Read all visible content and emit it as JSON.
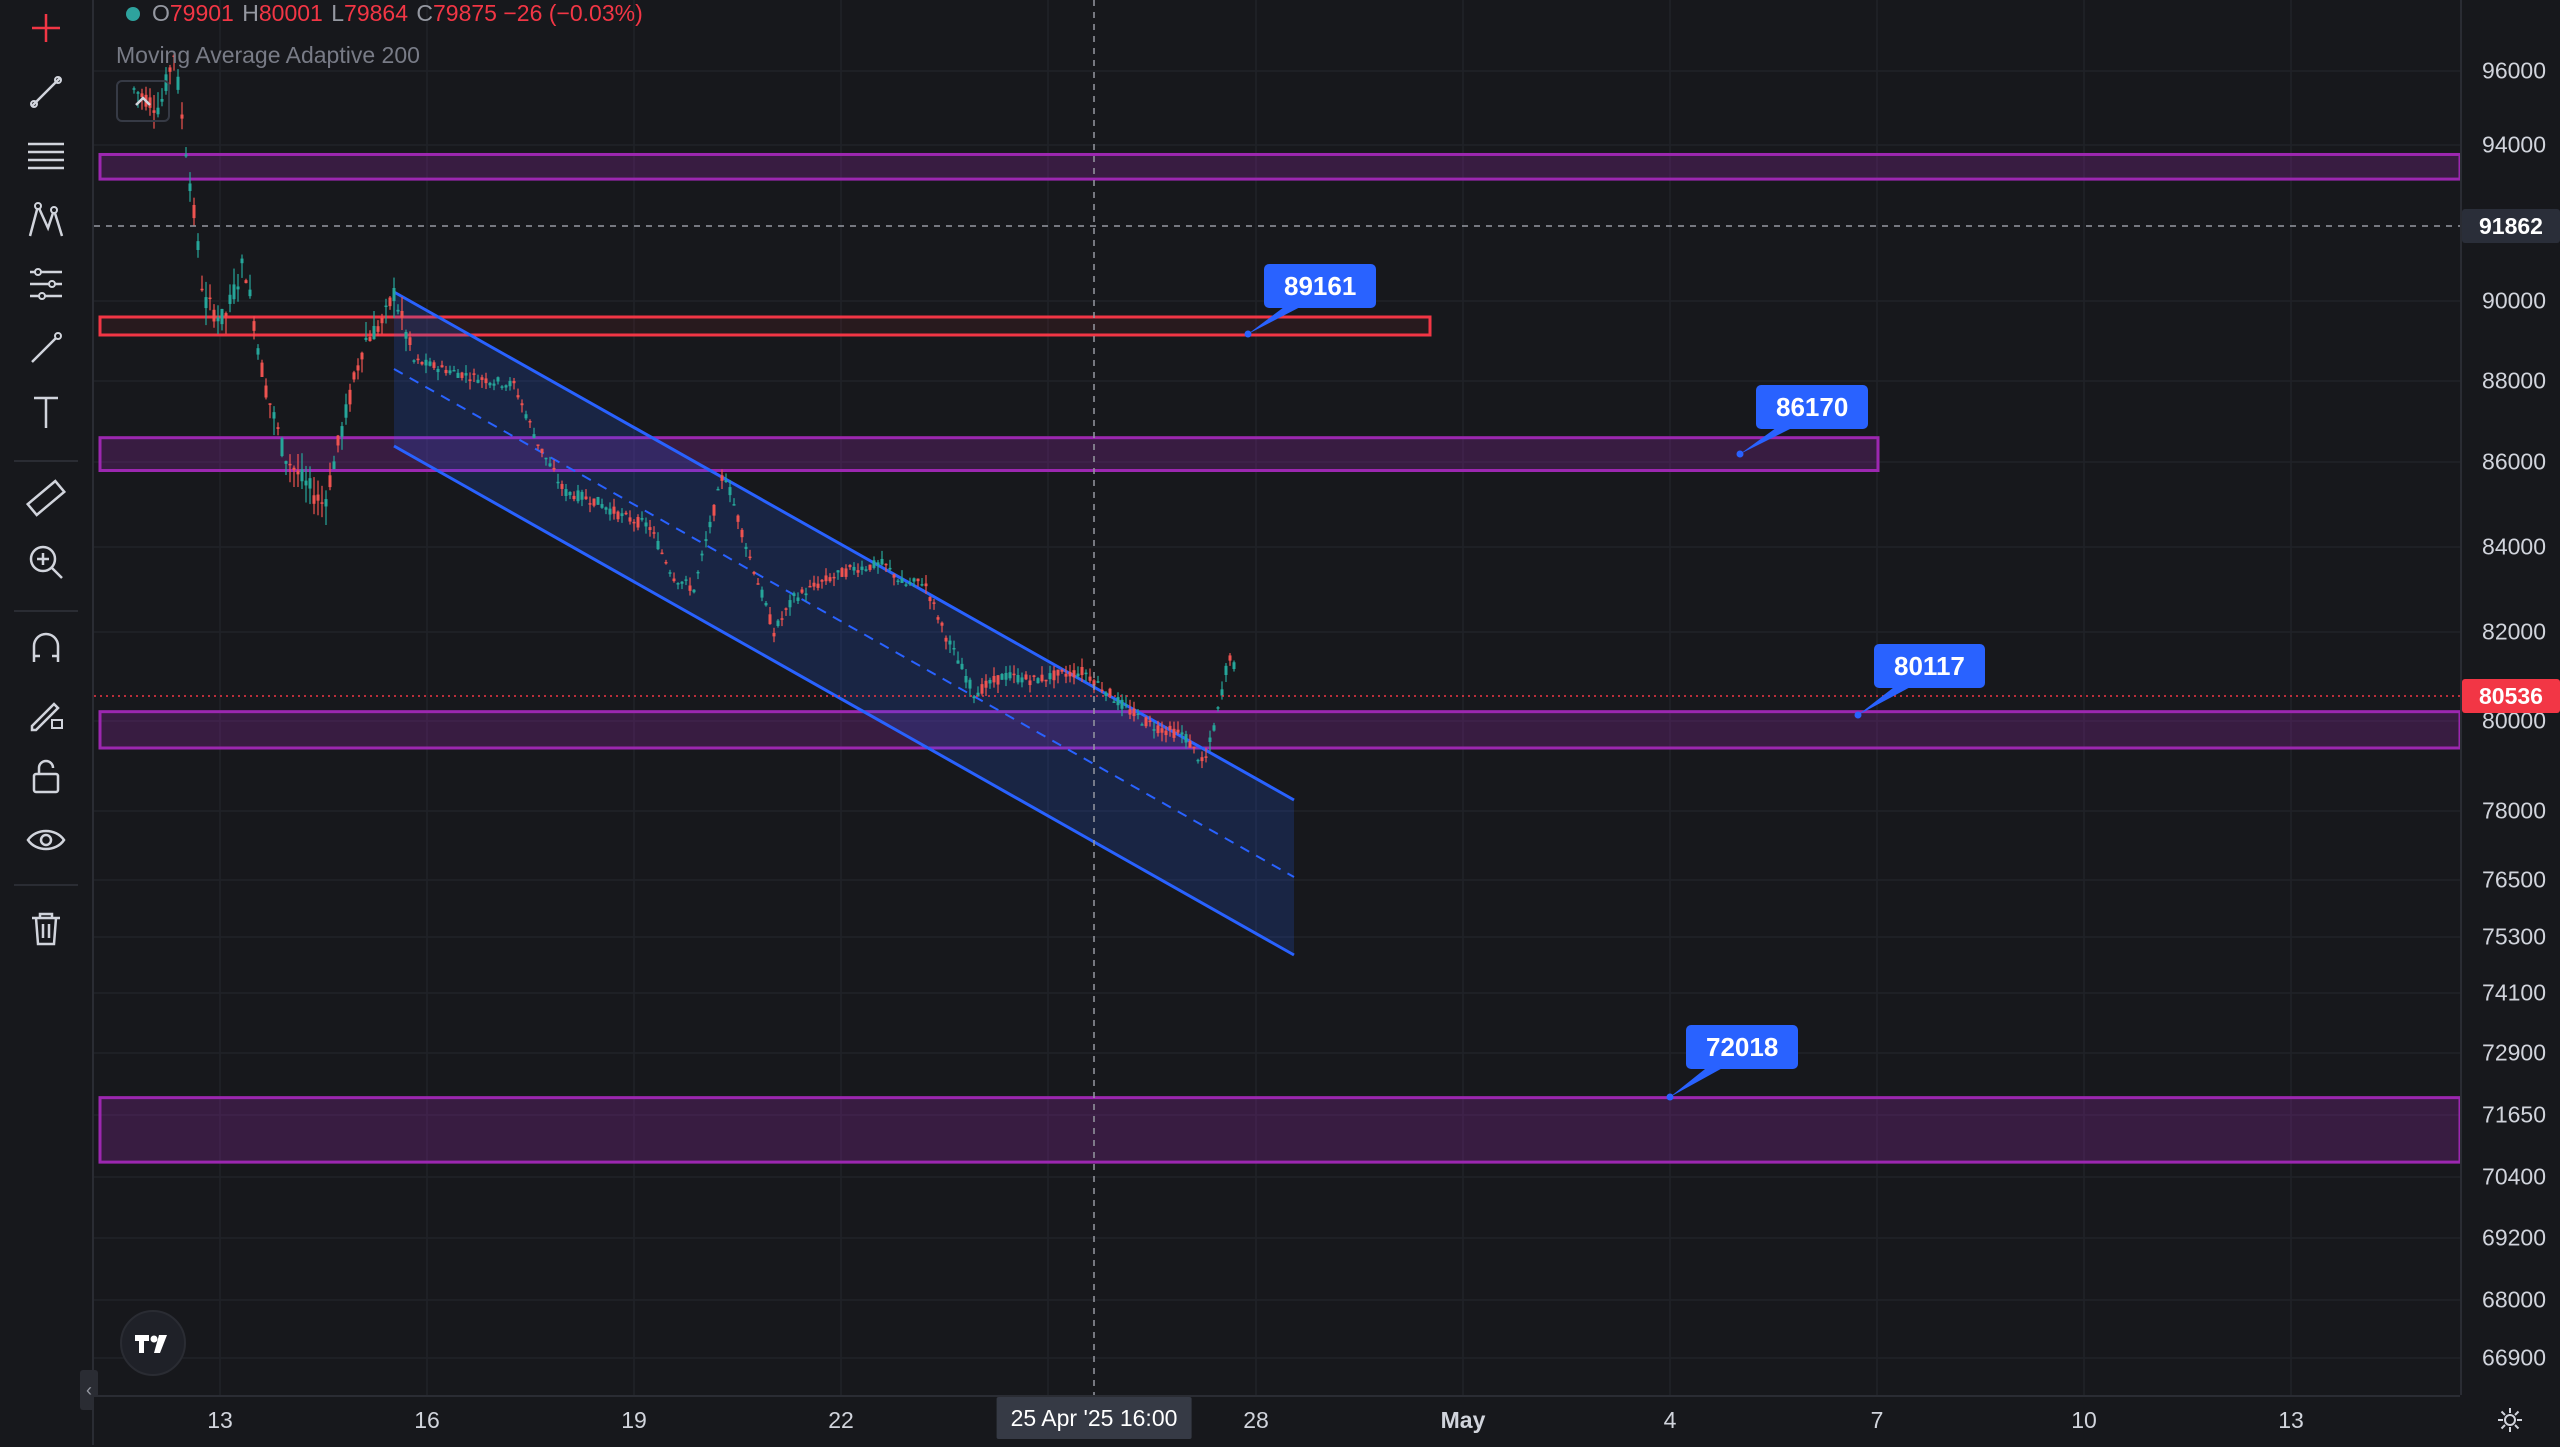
{
  "legend": {
    "open_label": "O",
    "open_value": "79901",
    "high_label": "H",
    "high_value": "80001",
    "low_label": "L",
    "low_value": "79864",
    "close_label": "C",
    "close_value": "79875",
    "change": "−26 (−0.03%)"
  },
  "indicator": {
    "name": "Moving Average Adaptive 200"
  },
  "price_axis": {
    "ticks": [
      "96000",
      "94000",
      "90000",
      "88000",
      "86000",
      "84000",
      "82000",
      "80000",
      "78000",
      "76500",
      "75300",
      "74100",
      "72900",
      "71650",
      "70400",
      "69200",
      "68000",
      "66900"
    ],
    "crosshair_price": "91862",
    "last_price": "80536"
  },
  "time_axis": {
    "ticks": [
      "13",
      "16",
      "19",
      "22",
      "28",
      "May",
      "4",
      "7",
      "10",
      "13"
    ],
    "crosshair_label": "25 Apr '25   16:00"
  },
  "callouts": {
    "c1": "89161",
    "c2": "86170",
    "c3": "80117",
    "c4": "72018"
  },
  "toolbar": {
    "tools": [
      "crosshair-icon",
      "trendline-icon",
      "fib-retracement-icon",
      "pattern-icon",
      "projection-icon",
      "brush-icon",
      "text-icon",
      "ruler-icon",
      "zoom-icon",
      "magnet-icon",
      "lock-drawing-icon",
      "unlock-icon",
      "eye-icon",
      "trash-icon"
    ]
  },
  "colors": {
    "background": "#17181c",
    "up": "#26a69a",
    "down": "#ef5350",
    "zone_purple": "#9c27b0",
    "channel_blue": "#2962ff",
    "resistance_red": "#f23645"
  }
}
